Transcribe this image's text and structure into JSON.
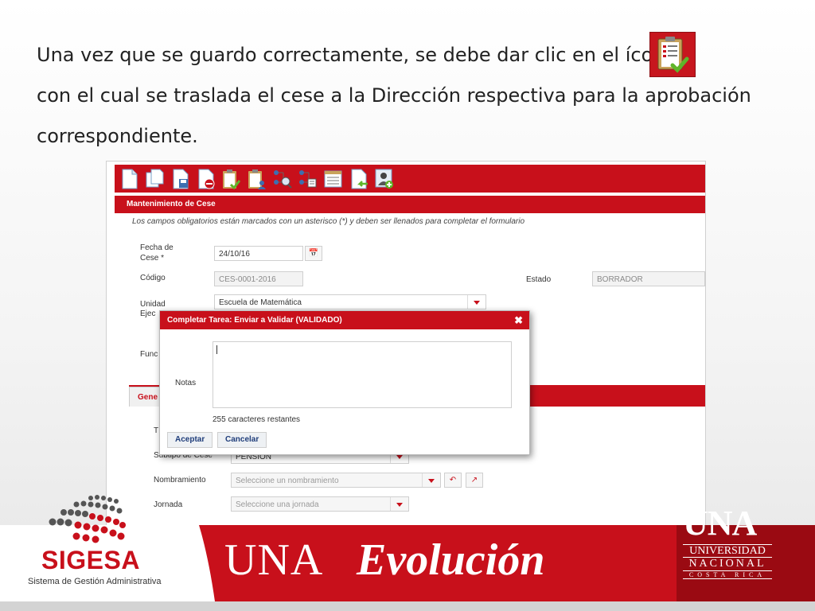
{
  "intro": {
    "text_before": "Una vez que se guardo correctamente, se debe dar clic en el ícono",
    "text_after": "con el cual se traslada el cese a la Dirección respectiva para la aprobación correspondiente.",
    "icon": "clipboard-check-icon"
  },
  "toolbar": {
    "icons": [
      "new-document-icon",
      "copy-document-icon",
      "save-document-icon",
      "delete-document-icon",
      "clipboard-check-icon",
      "clipboard-user-icon",
      "workflow-search-icon",
      "workflow-tree-icon",
      "document-list-icon",
      "document-return-icon",
      "user-add-icon"
    ]
  },
  "form": {
    "title": "Mantenimiento de Cese",
    "note": "Los campos obligatorios están marcados con un asterisco (*) y deben ser llenados para completar el formulario",
    "fecha_label_1": "Fecha de",
    "fecha_label_2": "Cese *",
    "fecha_value": "24/10/16",
    "codigo_label": "Código",
    "codigo_value": "CES-0001-2016",
    "estado_label": "Estado",
    "estado_value": "BORRADOR",
    "unidad_label_1": "Unidad",
    "unidad_label_2": "Ejec",
    "unidad_value": "Escuela de Matemática",
    "func_label": "Func",
    "tab_label": "Gene",
    "tipo_label": "T",
    "subtipo_label": "Subtipo de Cese",
    "subtipo_value": "PENSIÓN",
    "nombramiento_label": "Nombramiento",
    "nombramiento_placeholder": "Seleccione un nombramiento",
    "jornada_label": "Jornada",
    "jornada_placeholder": "Seleccione una jornada"
  },
  "dialog": {
    "title": "Completar Tarea: Enviar a Validar (VALIDADO)",
    "close": "✖",
    "notas_label": "Notas",
    "notas_value": "",
    "remaining": "255 caracteres restantes",
    "accept": "Aceptar",
    "cancel": "Cancelar"
  },
  "footer": {
    "sigesa_name": "SIGESA",
    "sigesa_sub": "Sistema de Gestión Administrativa",
    "una_prefix": "UNA",
    "evolucion": "Evolución",
    "una_logo": "UNA",
    "una_line1": "UNIVERSIDAD",
    "una_line2": "NACIONAL",
    "una_line3": "COSTA RICA"
  },
  "colors": {
    "accent": "#c8101b",
    "dark_red": "#9a0a12"
  }
}
